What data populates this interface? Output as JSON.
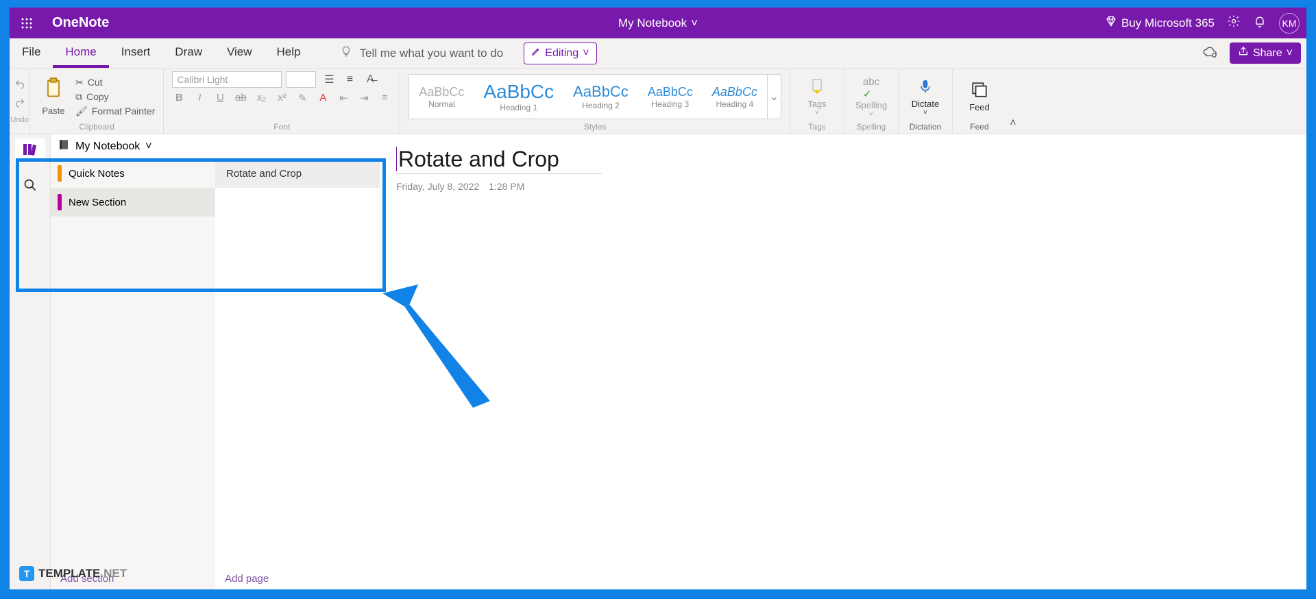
{
  "titlebar": {
    "appname": "OneNote",
    "notebook_title": "My Notebook",
    "buy_label": "Buy Microsoft 365",
    "avatar_initials": "KM"
  },
  "tabs": {
    "file": "File",
    "home": "Home",
    "insert": "Insert",
    "draw": "Draw",
    "view": "View",
    "help": "Help",
    "tellme_placeholder": "Tell me what you want to do",
    "editing_label": "Editing",
    "share_label": "Share"
  },
  "ribbon": {
    "undo_label": "Undo",
    "paste_label": "Paste",
    "cut_label": "Cut",
    "copy_label": "Copy",
    "format_painter_label": "Format Painter",
    "clipboard_caption": "Clipboard",
    "font_name": "Calibri Light",
    "font_caption": "Font",
    "styles_caption": "Styles",
    "styles": {
      "normal_sample": "AaBbCc",
      "normal_label": "Normal",
      "h1_sample": "AaBbCc",
      "h1_label": "Heading 1",
      "h2_sample": "AaBbCc",
      "h2_label": "Heading 2",
      "h3_sample": "AaBbCc",
      "h3_label": "Heading 3",
      "h4_sample": "AaBbCc",
      "h4_label": "Heading 4"
    },
    "tags_label": "Tags",
    "tags_caption": "Tags",
    "spelling_label": "Spelling",
    "spelling_caption": "Spelling",
    "dictate_label": "Dictate",
    "dictate_caption": "Dictation",
    "feed_label": "Feed",
    "feed_caption": "Feed"
  },
  "nav": {
    "notebook_name": "My Notebook",
    "sections": {
      "quick_notes": "Quick Notes",
      "new_section": "New Section"
    },
    "pages": {
      "rotate_crop": "Rotate and Crop"
    },
    "add_section": "Add section",
    "add_page": "Add page"
  },
  "page": {
    "title": "Rotate and Crop",
    "date": "Friday, July 8, 2022",
    "time": "1:28 PM"
  },
  "watermark": {
    "brand": "TEMPLATE",
    "suffix": ".NET"
  }
}
